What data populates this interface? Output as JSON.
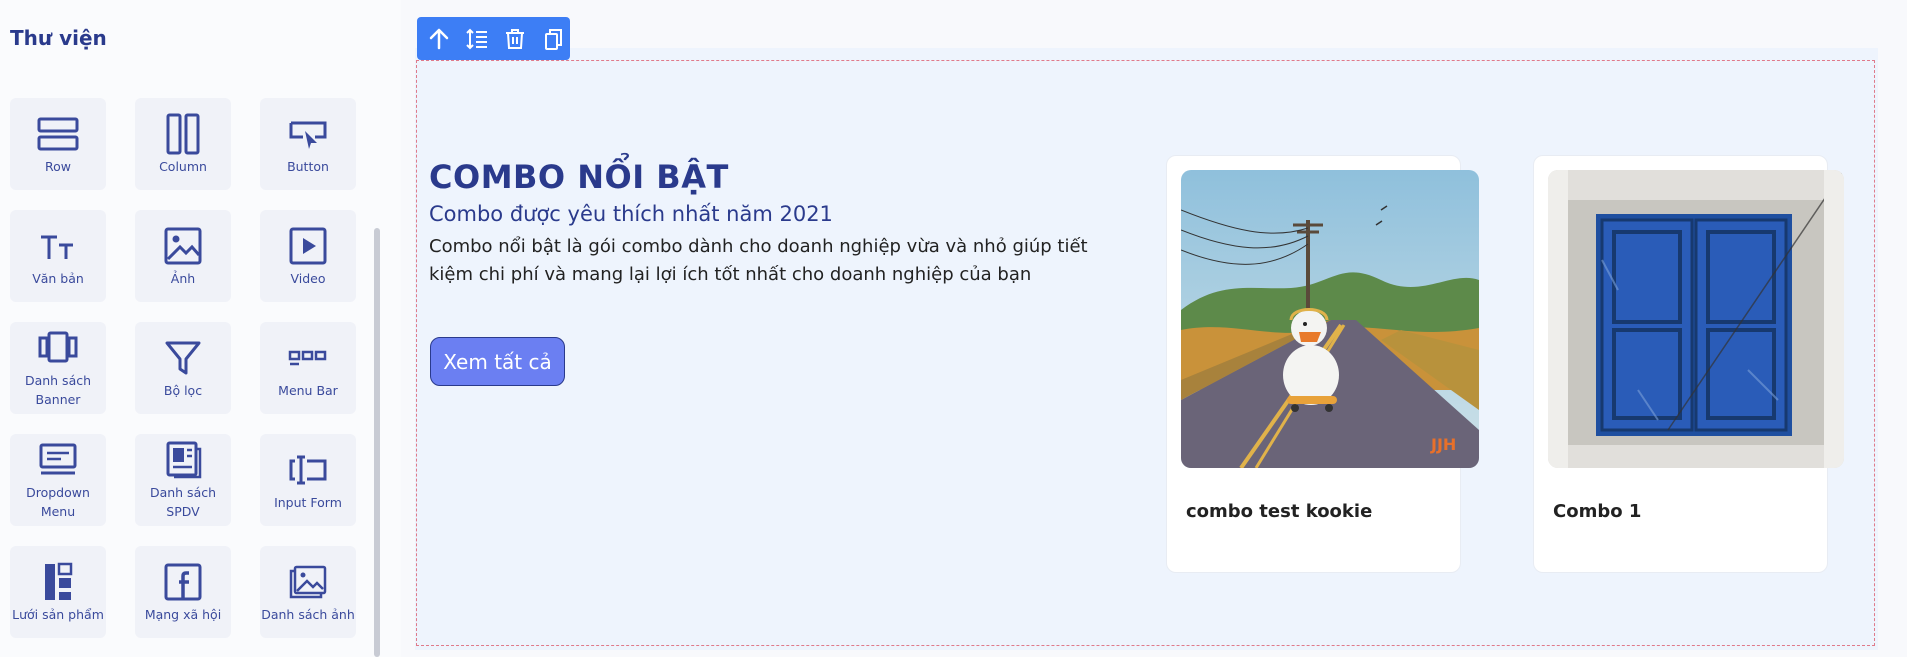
{
  "sidebar": {
    "title": "Thư viện",
    "items": [
      {
        "label": "Row",
        "icon": "row-icon"
      },
      {
        "label": "Column",
        "icon": "column-icon"
      },
      {
        "label": "Button",
        "icon": "button-icon"
      },
      {
        "label": "Văn bản",
        "icon": "text-icon"
      },
      {
        "label": "Ảnh",
        "icon": "image-icon"
      },
      {
        "label": "Video",
        "icon": "video-icon"
      },
      {
        "label": "Danh sách Banner",
        "icon": "banner-list-icon"
      },
      {
        "label": "Bộ lọc",
        "icon": "filter-icon"
      },
      {
        "label": "Menu Bar",
        "icon": "menu-bar-icon"
      },
      {
        "label": "Dropdown Menu",
        "icon": "dropdown-menu-icon"
      },
      {
        "label": "Danh sách SPDV",
        "icon": "product-list-icon"
      },
      {
        "label": "Input Form",
        "icon": "input-form-icon"
      },
      {
        "label": "Lưới sản phẩm",
        "icon": "product-grid-icon"
      },
      {
        "label": "Mạng xã hội",
        "icon": "facebook-icon"
      },
      {
        "label": "Danh sách ảnh",
        "icon": "image-list-icon"
      }
    ]
  },
  "toolbar": {
    "icons": [
      "arrow-up-icon",
      "line-spacing-icon",
      "trash-icon",
      "copy-icon"
    ],
    "color": "#3d7ef5"
  },
  "section": {
    "heading": "COMBO NỔI BẬT",
    "subheading": "Combo được yêu thích nhất năm 2021",
    "description": "Combo nổi bật là gói combo dành cho doanh nghiệp vừa và nhỏ giúp tiết kiệm chi phí và mang lại lợi ích tốt nhất cho doanh nghiệp của bạn",
    "cta_label": "Xem tất cả",
    "accent_color": "#2a3a8c",
    "button_color": "#6b7ff2"
  },
  "cards": [
    {
      "name": "combo test kookie",
      "image": "duck-skateboard-illustration"
    },
    {
      "name": "Combo 1",
      "image": "blue-window-shutters-photo"
    }
  ]
}
